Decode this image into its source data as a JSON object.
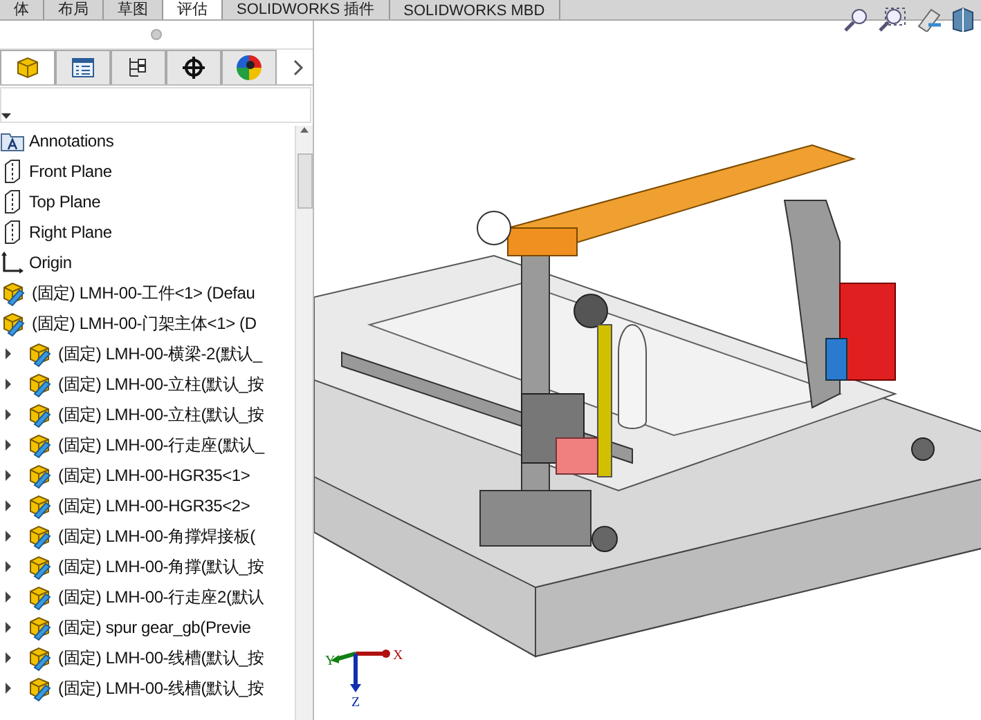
{
  "ribbon_tabs": [
    {
      "label": "体",
      "selected": false
    },
    {
      "label": "布局",
      "selected": false
    },
    {
      "label": "草图",
      "selected": false
    },
    {
      "label": "评估",
      "selected": true
    },
    {
      "label": "SOLIDWORKS 插件",
      "selected": false
    },
    {
      "label": "SOLIDWORKS MBD",
      "selected": false
    }
  ],
  "panel_tabs": [
    {
      "kind": "tree",
      "selected": true
    },
    {
      "kind": "properties",
      "selected": false
    },
    {
      "kind": "config",
      "selected": false
    },
    {
      "kind": "dimxpert",
      "selected": false
    },
    {
      "kind": "appearance",
      "selected": false
    }
  ],
  "tree": [
    {
      "kind": "annotations",
      "label": "Annotations"
    },
    {
      "kind": "plane",
      "label": "Front Plane"
    },
    {
      "kind": "plane",
      "label": "Top Plane"
    },
    {
      "kind": "plane",
      "label": "Right Plane"
    },
    {
      "kind": "origin",
      "label": "Origin"
    },
    {
      "kind": "assembly",
      "label": "(固定) LMH-00-工件<1> (Defau"
    },
    {
      "kind": "assembly",
      "label": "(固定) LMH-00-门架主体<1> (D",
      "children": [
        {
          "kind": "assembly",
          "label": "(固定) LMH-00-横梁-2(默认_",
          "expanded": false
        },
        {
          "kind": "assembly",
          "label": "(固定) LMH-00-立柱(默认_按",
          "expanded": false
        },
        {
          "kind": "assembly",
          "label": "(固定) LMH-00-立柱(默认_按",
          "expanded": false
        },
        {
          "kind": "assembly",
          "label": "(固定) LMH-00-行走座(默认_",
          "expanded": false
        },
        {
          "kind": "assembly",
          "label": "(固定) LMH-00-HGR35<1>",
          "expanded": false
        },
        {
          "kind": "assembly",
          "label": "(固定) LMH-00-HGR35<2>",
          "expanded": false
        },
        {
          "kind": "assembly",
          "label": "(固定) LMH-00-角撑焊接板(",
          "expanded": false
        },
        {
          "kind": "assembly",
          "label": "(固定) LMH-00-角撑(默认_按",
          "expanded": false
        },
        {
          "kind": "assembly",
          "label": "(固定) LMH-00-行走座2(默认",
          "expanded": false
        },
        {
          "kind": "assembly",
          "label": "(固定) spur gear_gb(Previe",
          "expanded": false
        },
        {
          "kind": "assembly",
          "label": "(固定) LMH-00-线槽(默认_按",
          "expanded": false
        },
        {
          "kind": "assembly",
          "label": "(固定) LMH-00-线槽(默认_按",
          "expanded": false
        }
      ]
    }
  ],
  "triad": {
    "x": "X",
    "y": "Y",
    "z": "Z"
  }
}
